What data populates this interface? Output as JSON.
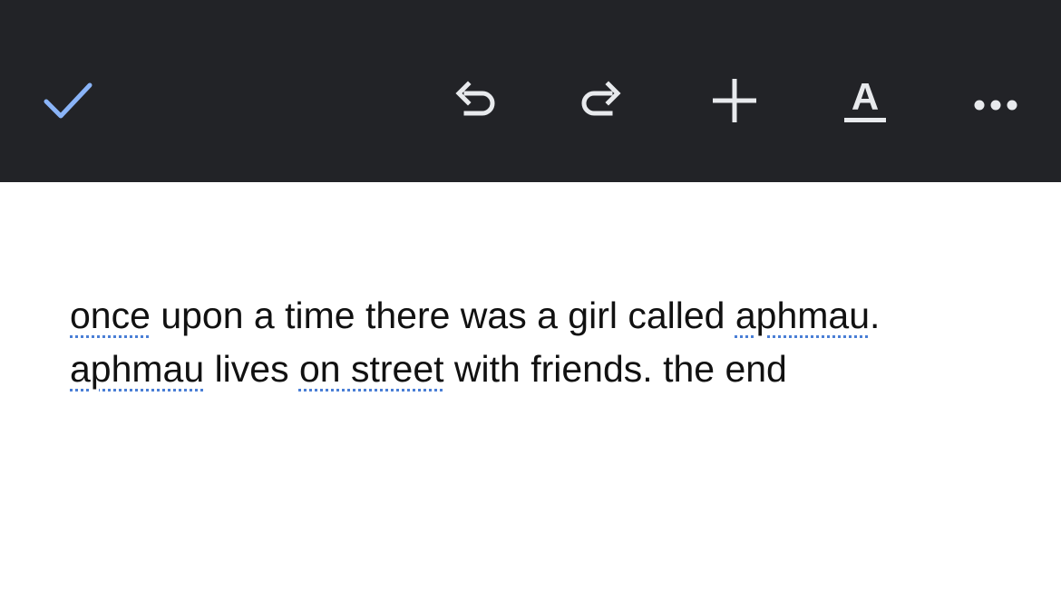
{
  "toolbar": {
    "background": "#222327",
    "accent": "#8ab4f8",
    "icon_color": "#e8eaed",
    "buttons": [
      {
        "id": "done",
        "icon": "check-icon"
      },
      {
        "id": "undo",
        "icon": "undo-icon"
      },
      {
        "id": "redo",
        "icon": "redo-icon"
      },
      {
        "id": "insert",
        "icon": "plus-icon"
      },
      {
        "id": "format",
        "icon": "text-format-icon",
        "glyph": "A"
      },
      {
        "id": "more",
        "icon": "more-horizontal-icon"
      }
    ]
  },
  "document": {
    "lines": [
      [
        {
          "text": "once",
          "misspelled": true
        },
        {
          "text": " upon a time there was a girl called ",
          "misspelled": false
        },
        {
          "text": "aphmau",
          "misspelled": true
        },
        {
          "text": ".",
          "misspelled": false
        }
      ],
      [
        {
          "text": "aphmau",
          "misspelled": true
        },
        {
          "text": " lives ",
          "misspelled": false
        },
        {
          "text": "on street",
          "misspelled": true
        },
        {
          "text": " with friends. the end",
          "misspelled": false
        }
      ]
    ],
    "spellcheck_underline_color": "#4a7fd6"
  }
}
